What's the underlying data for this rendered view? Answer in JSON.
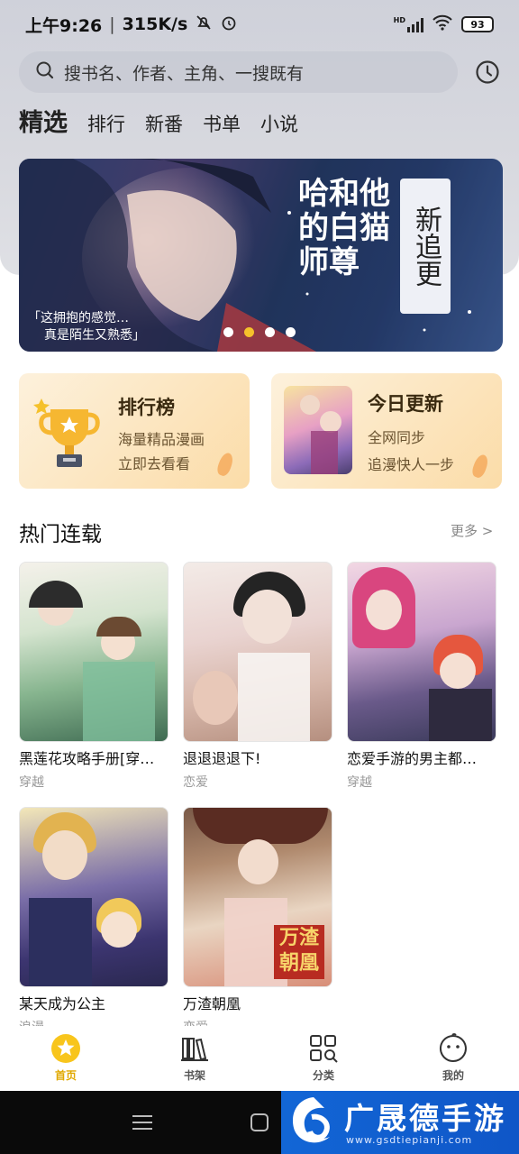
{
  "status": {
    "time": "上午9:26",
    "speed": "315K/s",
    "battery": "93",
    "hd": "HD"
  },
  "search": {
    "placeholder": "搜书名、作者、主角、一搜既有"
  },
  "tabs": [
    {
      "label": "精选",
      "active": true
    },
    {
      "label": "排行"
    },
    {
      "label": "新番"
    },
    {
      "label": "书单"
    },
    {
      "label": "小说"
    }
  ],
  "banner": {
    "badge": "新追更",
    "title": "哈和他的白猫师尊",
    "caption_line1": "「这拥抱的感觉…",
    "caption_line2": "真是陌生又熟悉」",
    "dots": 4,
    "active_dot": 1
  },
  "cards": {
    "ranking": {
      "title": "排行榜",
      "line1": "海量精品漫画",
      "line2": "立即去看看"
    },
    "update": {
      "title": "今日更新",
      "line1": "全网同步",
      "line2": "追漫快人一步"
    }
  },
  "section": {
    "title": "热门连载",
    "more": "更多 >"
  },
  "comics": [
    {
      "title": "黑莲花攻略手册[穿…",
      "genre": "穿越"
    },
    {
      "title": "退退退退下!",
      "genre": "恋爱"
    },
    {
      "title": "恋爱手游的男主都…",
      "genre": "穿越"
    },
    {
      "title": "某天成为公主",
      "genre": "浪漫"
    },
    {
      "title": "万渣朝凰",
      "genre": "恋爱"
    }
  ],
  "nav": [
    {
      "label": "首页",
      "icon": "star-icon",
      "active": true
    },
    {
      "label": "书架",
      "icon": "bookshelf-icon"
    },
    {
      "label": "分类",
      "icon": "category-icon"
    },
    {
      "label": "我的",
      "icon": "face-icon"
    }
  ],
  "watermark": {
    "text": "广晟德手游",
    "url": "www.gsdtiepianji.com"
  },
  "colors": {
    "accent": "#f5c12b",
    "watermark_bg": "#1266d6"
  }
}
